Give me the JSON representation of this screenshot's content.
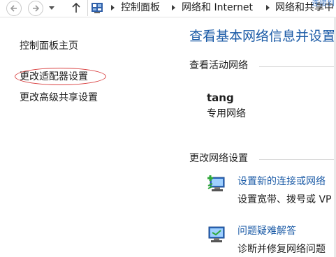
{
  "address_bar": {
    "breadcrumbs": [
      "控制面板",
      "网络和 Internet",
      "网络和共享中"
    ],
    "corner_text": "连接到",
    "icons": {
      "back": "back-arrow-icon",
      "forward": "forward-arrow-icon",
      "up": "up-arrow-icon",
      "location": "control-panel-icon"
    }
  },
  "sidebar": {
    "items": [
      {
        "label": "控制面板主页"
      },
      {
        "label": "更改适配器设置",
        "highlighted": true
      },
      {
        "label": "更改高级共享设置"
      }
    ],
    "highlight_color": "#d94040"
  },
  "main": {
    "title": "查看基本网络信息并设置",
    "active_networks_heading": "查看活动网络",
    "network": {
      "name": "tang",
      "type": "专用网络"
    },
    "change_settings_heading": "更改网络设置",
    "tasks": [
      {
        "link": "设置新的连接或网络",
        "description": "设置宽带、拨号或 VP",
        "icon": "new-connection-icon"
      },
      {
        "link": "问题疑难解答",
        "description": "诊断并修复网络问题",
        "icon": "troubleshoot-icon"
      }
    ],
    "link_color": "#1a5aa6"
  }
}
